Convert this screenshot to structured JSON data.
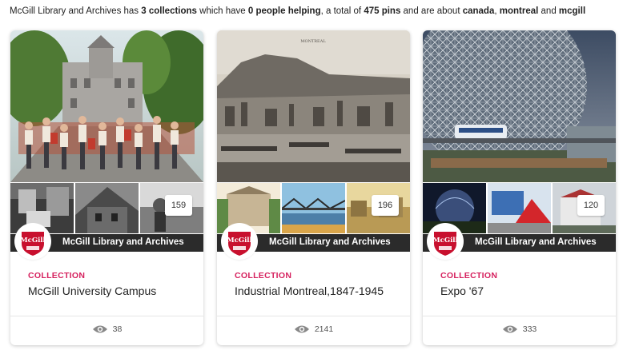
{
  "summary": {
    "prefix": "McGill Library and Archives has ",
    "collections_bold": "3 collections",
    "mid1": " which have ",
    "people_bold": "0 people helping",
    "mid2": ", a total of ",
    "pins_bold": "475 pins",
    "mid3": " and are about ",
    "tag1": "canada",
    "sep1": ", ",
    "tag2": "montreal",
    "sep2": " and ",
    "tag3": "mcgill"
  },
  "colors": {
    "accent": "#d6215e",
    "owner_bar": "#2b2b2b",
    "logo_red": "#c8102e"
  },
  "cards": [
    {
      "pin_count": "159",
      "owner": "McGill Library and Archives",
      "type_label": "COLLECTION",
      "title": "McGill University Campus",
      "views": "38",
      "icon": "eye-icon"
    },
    {
      "pin_count": "196",
      "owner": "McGill Library and Archives",
      "type_label": "COLLECTION",
      "title": "Industrial Montreal,1847-1945",
      "views": "2141",
      "icon": "eye-icon"
    },
    {
      "pin_count": "120",
      "owner": "McGill Library and Archives",
      "type_label": "COLLECTION",
      "title": "Expo '67",
      "views": "333",
      "icon": "eye-icon"
    }
  ],
  "logo_text": "McGill"
}
